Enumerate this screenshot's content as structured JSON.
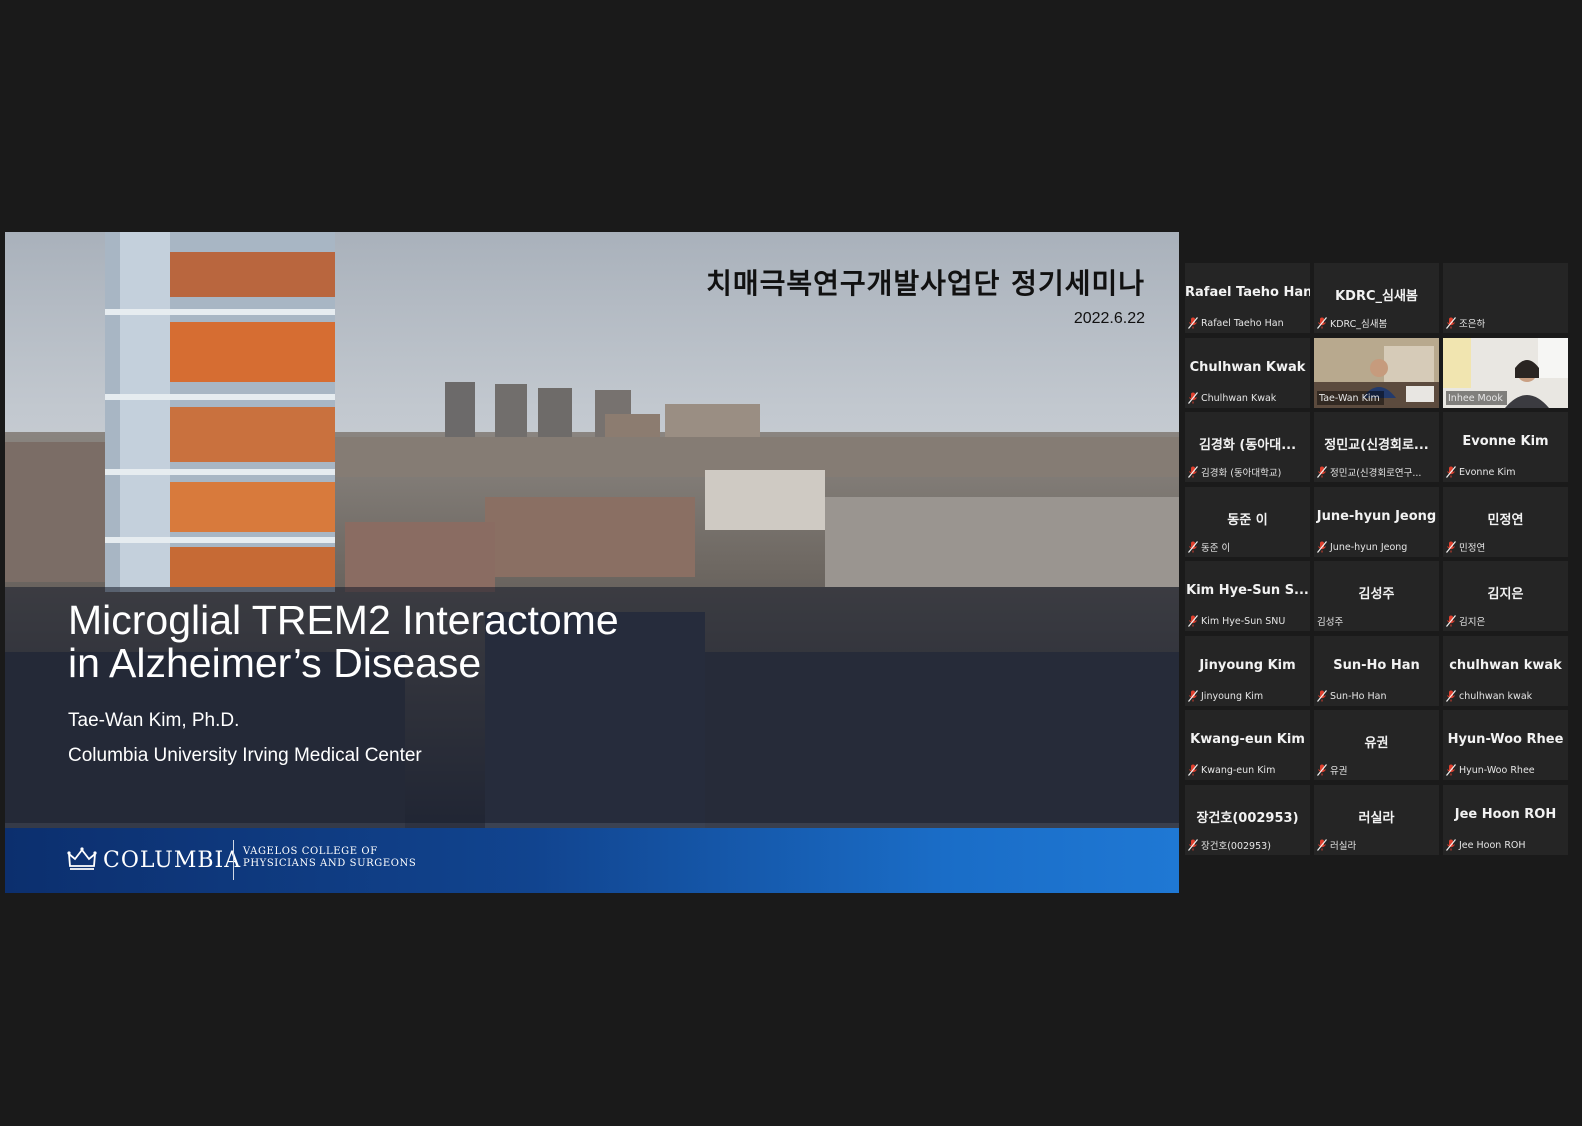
{
  "slide": {
    "header": "치매극복연구개발사업단 정기세미나",
    "date": "2022.6.22",
    "title_line1": "Microglial TREM2 Interactome",
    "title_line2": "in Alzheimer’s Disease",
    "author": "Tae-Wan Kim, Ph.D.",
    "affiliation": "Columbia University Irving Medical Center",
    "logo_wordmark": "COLUMBIA",
    "logo_sub1": "VAGELOS COLLEGE OF",
    "logo_sub2": "PHYSICIANS AND SURGEONS",
    "footer_color": "#1a6dc7"
  },
  "gallery": {
    "active_speaker_color": "#d7e84a",
    "muted_icon": "mic-off-icon",
    "participants": [
      {
        "name": "Rafael Taeho Han",
        "label": "Rafael Taeho Han",
        "muted": true
      },
      {
        "name": "KDRC_심새봄",
        "label": "KDRC_심새봄",
        "muted": true
      },
      {
        "name": "",
        "label": "조은하",
        "muted": true
      },
      {
        "name": "Chulhwan Kwak",
        "label": "Chulhwan Kwak",
        "muted": true
      },
      {
        "name": "",
        "label": "Tae-Wan Kim",
        "muted": false,
        "video": true,
        "active": true
      },
      {
        "name": "",
        "label": "Inhee Mook",
        "muted": false,
        "video": true
      },
      {
        "name": "김경화 (동아대...",
        "label": "김경화 (동아대학교)",
        "muted": true
      },
      {
        "name": "정민교(신경회로...",
        "label": "정민교(신경회로연구...",
        "muted": true
      },
      {
        "name": "Evonne Kim",
        "label": "Evonne Kim",
        "muted": true
      },
      {
        "name": "동준 이",
        "label": "동준 이",
        "muted": true
      },
      {
        "name": "June-hyun Jeong",
        "label": "June-hyun Jeong",
        "muted": true
      },
      {
        "name": "민정연",
        "label": "민정연",
        "muted": true
      },
      {
        "name": "Kim Hye-Sun S...",
        "label": "Kim Hye-Sun SNU",
        "muted": true
      },
      {
        "name": "김성주",
        "label": "김성주",
        "muted": false
      },
      {
        "name": "김지은",
        "label": "김지은",
        "muted": true
      },
      {
        "name": "Jinyoung Kim",
        "label": "Jinyoung Kim",
        "muted": true
      },
      {
        "name": "Sun-Ho Han",
        "label": "Sun-Ho Han",
        "muted": true
      },
      {
        "name": "chulhwan kwak",
        "label": "chulhwan kwak",
        "muted": true
      },
      {
        "name": "Kwang-eun Kim",
        "label": "Kwang-eun Kim",
        "muted": true
      },
      {
        "name": "유권",
        "label": "유권",
        "muted": true
      },
      {
        "name": "Hyun-Woo Rhee",
        "label": "Hyun-Woo Rhee",
        "muted": true
      },
      {
        "name": "장건호(002953)",
        "label": "장건호(002953)",
        "muted": true
      },
      {
        "name": "러실라",
        "label": "러실라",
        "muted": true
      },
      {
        "name": "Jee Hoon ROH",
        "label": "Jee Hoon ROH",
        "muted": true
      }
    ]
  }
}
